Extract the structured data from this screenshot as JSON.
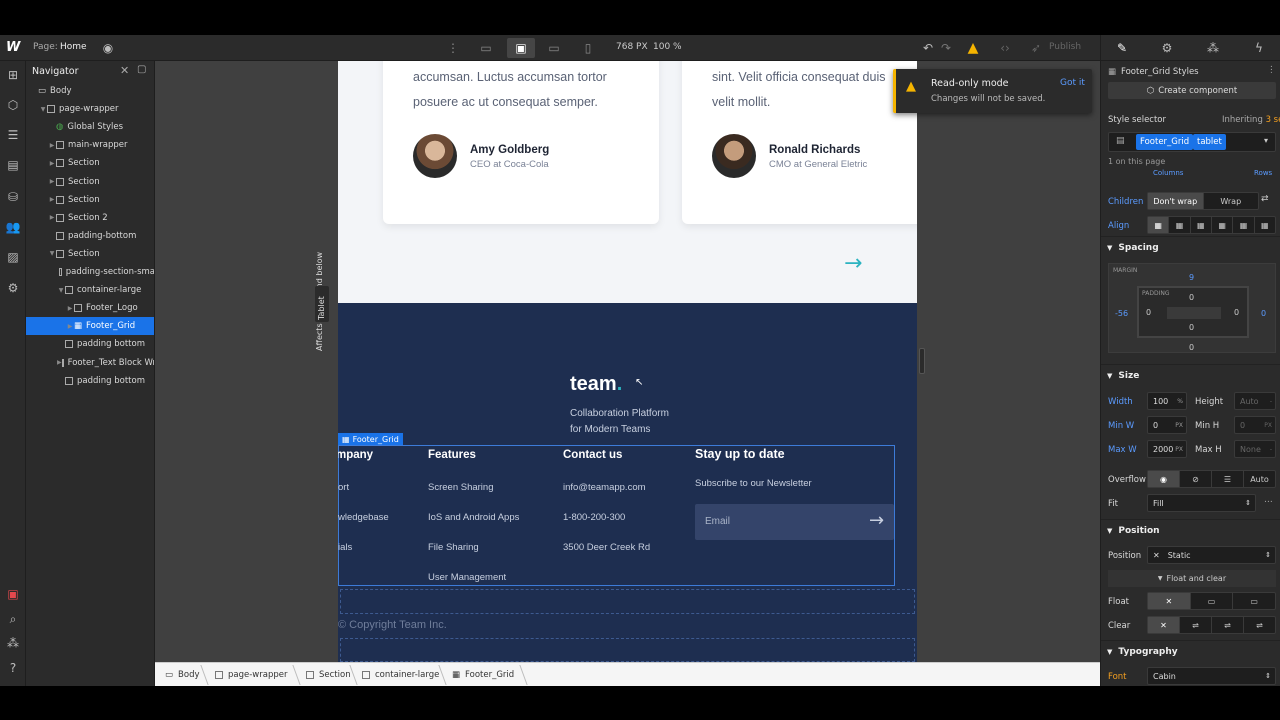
{
  "topbar": {
    "page_label": "Page:",
    "page_name": "Home",
    "width_px": "768 PX",
    "zoom": "100 %",
    "publish": "Publish"
  },
  "navigator": {
    "title": "Navigator",
    "items": [
      {
        "label": "Body",
        "indent": 0,
        "caret": false,
        "icon": "body"
      },
      {
        "label": "page-wrapper",
        "indent": 1,
        "caret": true,
        "icon": "box"
      },
      {
        "label": "Global Styles",
        "indent": 2,
        "caret": false,
        "icon": "global"
      },
      {
        "label": "main-wrapper",
        "indent": 2,
        "caret": true,
        "icon": "box"
      },
      {
        "label": "Section",
        "indent": 2,
        "caret": true,
        "icon": "box"
      },
      {
        "label": "Section",
        "indent": 2,
        "caret": true,
        "icon": "box"
      },
      {
        "label": "Section",
        "indent": 2,
        "caret": true,
        "icon": "box"
      },
      {
        "label": "Section 2",
        "indent": 2,
        "caret": true,
        "icon": "box"
      },
      {
        "label": "padding-bottom",
        "indent": 2,
        "caret": false,
        "icon": "box"
      },
      {
        "label": "Section",
        "indent": 2,
        "caret": true,
        "icon": "box"
      },
      {
        "label": "padding-section-sma",
        "indent": 3,
        "caret": false,
        "icon": "box"
      },
      {
        "label": "container-large",
        "indent": 3,
        "caret": true,
        "icon": "box"
      },
      {
        "label": "Footer_Logo",
        "indent": 4,
        "caret": true,
        "icon": "box"
      },
      {
        "label": "Footer_Grid",
        "indent": 4,
        "caret": true,
        "icon": "grid",
        "selected": true
      },
      {
        "label": "padding bottom",
        "indent": 3,
        "caret": false,
        "icon": "box"
      },
      {
        "label": "Footer_Text Block Wra",
        "indent": 3,
        "caret": true,
        "icon": "box"
      },
      {
        "label": "padding bottom",
        "indent": 3,
        "caret": false,
        "icon": "box"
      }
    ]
  },
  "canvas": {
    "breakpoint_note": "Affects 991px and below",
    "breakpoint_tab": "Tablet",
    "toast": {
      "title": "Read-only mode",
      "body": "Changes will not be saved.",
      "action": "Got it"
    },
    "testimonials": [
      {
        "text1": "accumsan. Luctus accumsan tortor",
        "text2": "posuere ac ut consequat semper.",
        "name": "Amy Goldberg",
        "role": "CEO at Coca-Cola"
      },
      {
        "text1": "sint. Velit officia consequat duis",
        "text2": "velit mollit.",
        "name": "Ronald Richards",
        "role": "CMO at General Eletric"
      }
    ],
    "arrow": "→",
    "footer": {
      "logo": "team",
      "logo_dot": ".",
      "tagline1": "Collaboration Platform",
      "tagline2": "for Modern Teams",
      "grid_badge": "Footer_Grid",
      "company_head": "mpany",
      "company_items": [
        "ort",
        "wledgebase",
        "ials"
      ],
      "features_head": "Features",
      "features_items": [
        "Screen Sharing",
        "IoS and Android Apps",
        "File Sharing",
        "User Management"
      ],
      "contact_head": "Contact us",
      "contact_items": [
        "info@teamapp.com",
        "1-800-200-300",
        "3500 Deer Creek Rd"
      ],
      "newsletter_head": "Stay up to date",
      "newsletter_sub": "Subscribe to our Newsletter",
      "email_placeholder": "Email",
      "copyright": "© Copyright Team Inc."
    }
  },
  "breadcrumbs": [
    "Body",
    "page-wrapper",
    "Section",
    "container-large",
    "Footer_Grid"
  ],
  "panel": {
    "styles_title": "Footer_Grid Styles",
    "create_component": "Create component",
    "style_selector": "Style selector",
    "inheriting": "Inheriting",
    "inheriting_count": "3 selectors",
    "class_tag": "Footer_Grid",
    "state_tag": "tablet",
    "on_page": "1 on this page",
    "columns": "Columns",
    "rows": "Rows",
    "children_label": "Children",
    "dont_wrap": "Don't wrap",
    "wrap": "Wrap",
    "align_label": "Align",
    "spacing_head": "Spacing",
    "margin_label": "MARGIN",
    "padding_label": "PADDING",
    "margin_top": "9",
    "margin_left": "-56",
    "margin_right": "0",
    "margin_bottom": "0",
    "padding_top": "0",
    "padding_left": "0",
    "padding_right": "0",
    "padding_bottom": "0",
    "size_head": "Size",
    "width_label": "Width",
    "width_val": "100",
    "width_unit": "%",
    "height_label": "Height",
    "height_val": "Auto",
    "height_unit": "-",
    "minw_label": "Min W",
    "minw_val": "0",
    "minw_unit": "PX",
    "minh_label": "Min H",
    "minh_val": "0",
    "minh_unit": "PX",
    "maxw_label": "Max W",
    "maxw_val": "2000",
    "maxw_unit": "PX",
    "maxh_label": "Max H",
    "maxh_val": "None",
    "maxh_unit": "-",
    "overflow_label": "Overflow",
    "overflow_auto": "Auto",
    "fit_label": "Fit",
    "fit_val": "Fill",
    "position_head": "Position",
    "position_label": "Position",
    "position_val": "Static",
    "float_clear": "Float and clear",
    "float_label": "Float",
    "clear_label": "Clear",
    "typography_head": "Typography",
    "font_label": "Font",
    "font_val": "Cabin"
  },
  "colors": {
    "accent": "#1a73e8",
    "footer_bg": "#1e2e50",
    "teal": "#2bb3c0",
    "warning": "#f5b400"
  }
}
